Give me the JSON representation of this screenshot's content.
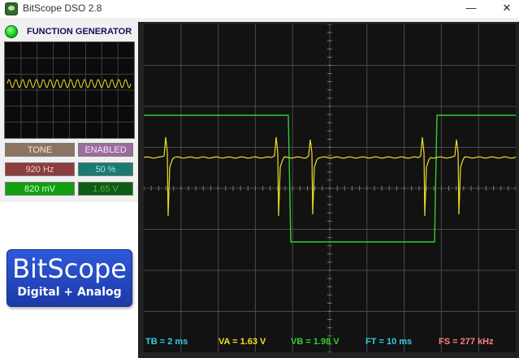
{
  "window": {
    "title": "BitScope DSO 2.8",
    "min_symbol": "—",
    "close_symbol": "✕"
  },
  "function_generator": {
    "title": "FUNCTION GENERATOR",
    "mode_label": "TONE",
    "state_label": "ENABLED",
    "frequency": "920 Hz",
    "duty": "50 %",
    "amplitude": "820 mV",
    "offset": "1.65 V"
  },
  "logo": {
    "title": "BitScope",
    "subtitle": "Digital + Analog"
  },
  "readouts": {
    "tb": "TB = 2 ms",
    "va": "VA = 1.63 V",
    "vb": "VB = 1.98 V",
    "ft": "FT = 10 ms",
    "fs": "FS = 277 kHz"
  },
  "colors": {
    "channel_a": "#f0e020",
    "channel_b": "#30d030",
    "grid": "#4a4a4a",
    "tb_color": "#30d0e0",
    "va_color": "#f0e020",
    "vb_color": "#30d030",
    "ft_color": "#30d0e0",
    "fs_color": "#ff8080"
  },
  "icons": {
    "app": "bitscope-app-icon",
    "led": "status-led-icon"
  }
}
